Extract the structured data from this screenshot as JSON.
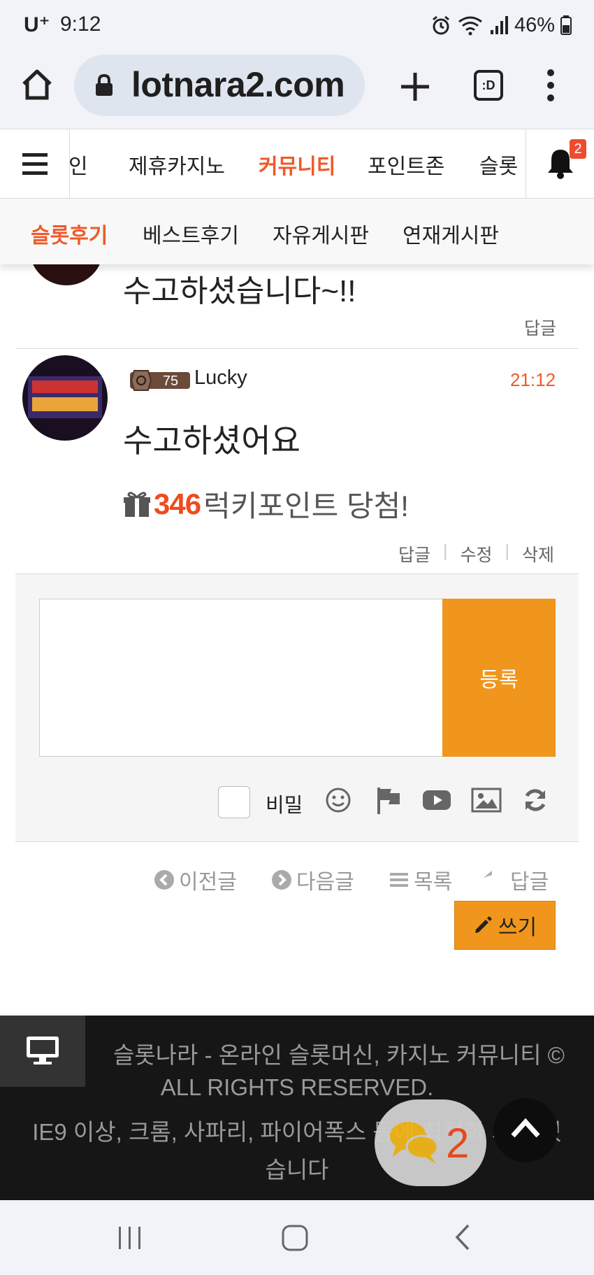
{
  "status": {
    "carrier": "U⁺",
    "time": "9:12",
    "battery": "46%"
  },
  "browser": {
    "url": "lotnara2.com",
    "tabs_label": ":D"
  },
  "nav": {
    "items": [
      "인",
      "제휴카지노",
      "커뮤니티",
      "포인트존",
      "슬롯"
    ],
    "active": "커뮤니티",
    "notification_count": "2"
  },
  "subnav": {
    "items": [
      "슬롯후기",
      "베스트후기",
      "자유게시판",
      "연재게시판"
    ]
  },
  "comments": {
    "prev_text": "수고하셨습니다~!!",
    "prev_reply": "답글",
    "author": "Lucky",
    "level": "75",
    "time": "21:12",
    "text": "수고하셨어요",
    "lucky_points": "346",
    "lucky_text": "럭키포인트 당첨!",
    "actions": [
      "답글",
      "수정",
      "삭제"
    ]
  },
  "form": {
    "submit_label": "등록",
    "secret_label": "비밀"
  },
  "post_nav": {
    "prev": "이전글",
    "next": "다음글",
    "list": "목록",
    "reply": "답글",
    "write": "쓰기"
  },
  "footer": {
    "line1": "슬롯나라 - 온라인 슬롯머신, 카지노 커뮤니티 ©",
    "line2": "ALL RIGHTS RESERVED.",
    "line3": "IE9 이상, 크롬, 사파리, 파이어폭스 등에 최적화 되어 있",
    "line4": "습니다"
  },
  "chat": {
    "count": "2"
  },
  "colors": {
    "accent": "#ef5a2a",
    "button": "#f0961c"
  }
}
